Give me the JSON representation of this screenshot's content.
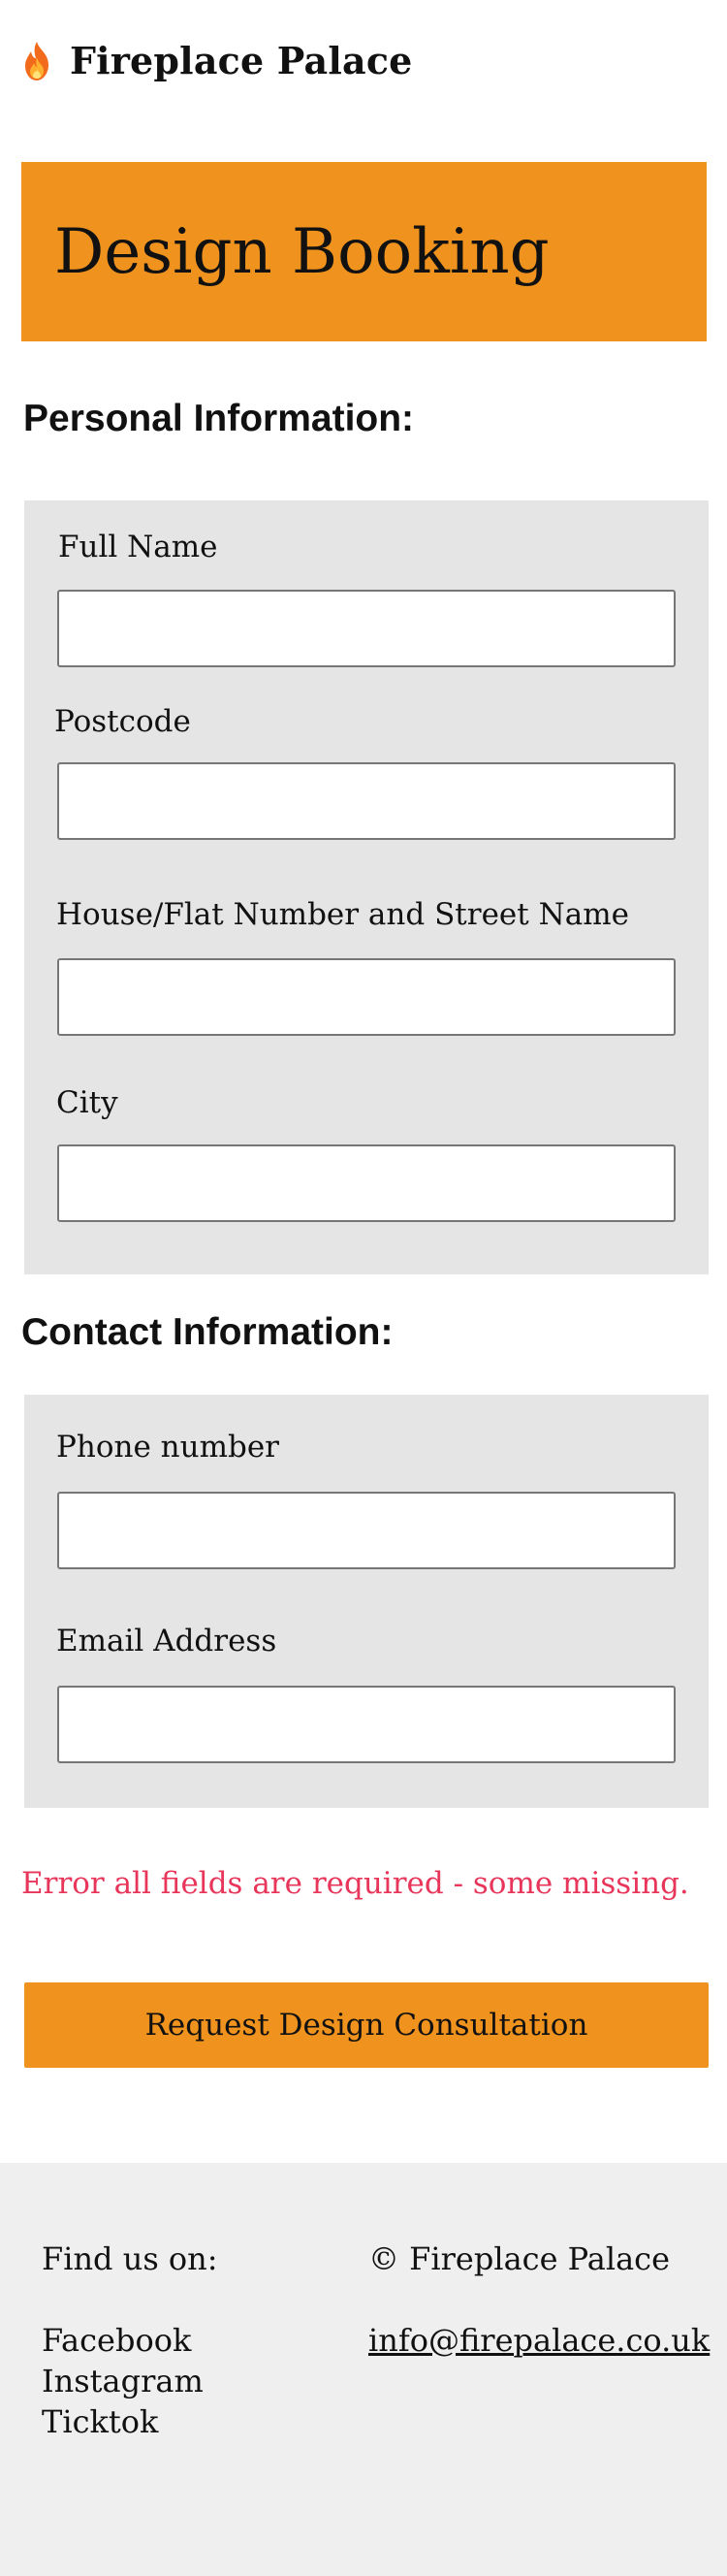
{
  "header": {
    "brand": "Fireplace Palace",
    "logo_icon": "fire-icon"
  },
  "hero": {
    "title": "Design Booking"
  },
  "personal_section": {
    "heading": "Personal Information:",
    "fields": [
      {
        "label": "Full Name",
        "value": "",
        "placeholder": ""
      },
      {
        "label": "Postcode",
        "value": "",
        "placeholder": ""
      },
      {
        "label": "House/Flat Number and Street Name",
        "value": "",
        "placeholder": ""
      },
      {
        "label": "City",
        "value": "",
        "placeholder": ""
      }
    ]
  },
  "contact_section": {
    "heading": "Contact Information:",
    "fields": [
      {
        "label": "Phone number",
        "value": "",
        "placeholder": ""
      },
      {
        "label": "Email Address",
        "value": "",
        "placeholder": ""
      }
    ]
  },
  "error": {
    "message": "Error all fields are required - some missing."
  },
  "submit": {
    "label": "Request Design Consultation"
  },
  "footer": {
    "find_us_label": "Find us on:",
    "social_links": [
      "Facebook",
      "Instagram",
      "Ticktok"
    ],
    "copyright": "© Fireplace Palace",
    "email": "info@firepalace.co.uk"
  },
  "colors": {
    "accent": "#f0931e",
    "error": "#e8355a",
    "panel_bg": "#e5e5e5",
    "footer_bg": "#efefef"
  }
}
